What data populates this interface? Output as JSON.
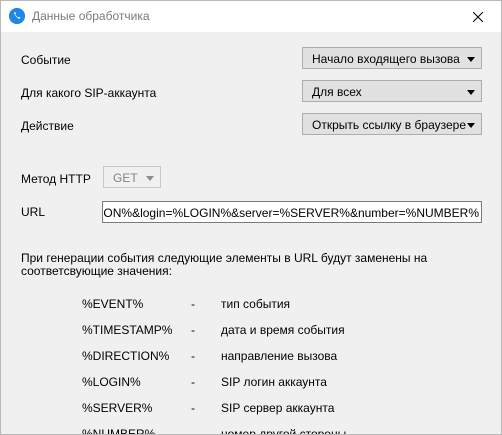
{
  "window": {
    "title": "Данные обработчика"
  },
  "fields": {
    "event": {
      "label": "Событие",
      "value": "Начало входящего вызова"
    },
    "sip_account": {
      "label": "Для какого SIP-аккаунта",
      "value": "Для всех"
    },
    "action": {
      "label": "Действие",
      "value": "Открыть ссылку в браузере"
    },
    "http_method": {
      "label": "Метод HTTP",
      "value": "GET",
      "enabled": false
    },
    "url": {
      "label": "URL",
      "value": "IRECTION%&login=%LOGIN%&server=%SERVER%&number=%NUMBER%"
    }
  },
  "description": "При генерации события следующие элементы в URL будут заменены на соответсвующие значения:",
  "placeholders": [
    {
      "token": "%EVENT%",
      "dash": "-",
      "meaning": "тип события"
    },
    {
      "token": "%TIMESTAMP%",
      "dash": "-",
      "meaning": "дата и время события"
    },
    {
      "token": "%DIRECTION%",
      "dash": "-",
      "meaning": "направление вызова"
    },
    {
      "token": "%LOGIN%",
      "dash": "-",
      "meaning": "SIP логин аккаунта"
    },
    {
      "token": "%SERVER%",
      "dash": "-",
      "meaning": "SIP сервер аккаунта"
    },
    {
      "token": "%NUMBER%",
      "dash": "-",
      "meaning": "номер другой стороны"
    }
  ],
  "colors": {
    "accent": "#1e88e5",
    "window_bg": "#f0f0f0",
    "combo_bg": "#e1e1e1"
  }
}
